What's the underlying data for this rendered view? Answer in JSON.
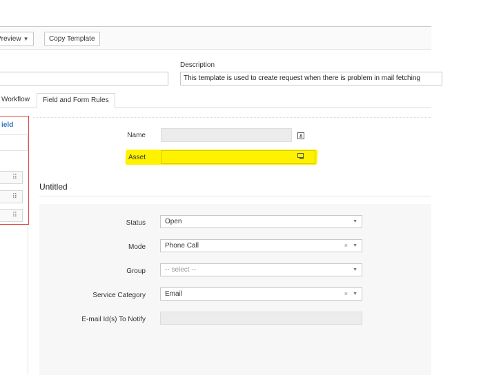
{
  "toolbar": {
    "preview_label": "Preview",
    "copy_template_label": "Copy Template"
  },
  "header": {
    "description_label": "Description",
    "description_value": "This template is used to create request when there is problem in mail fetching"
  },
  "tabs": [
    {
      "label": "Workflow"
    },
    {
      "label": "Field and Form Rules"
    }
  ],
  "left_panel": {
    "title": "ield",
    "handle_glyph": "⠿"
  },
  "main": {
    "name_label": "Name",
    "asset_label": "Asset",
    "highlight_color": "#fff200",
    "section_title": "Untitled",
    "fields": [
      {
        "label": "Status",
        "value": "Open",
        "clearable": false,
        "placeholder": false
      },
      {
        "label": "Mode",
        "value": "Phone Call",
        "clearable": true,
        "placeholder": false
      },
      {
        "label": "Group",
        "value": "-- select --",
        "clearable": false,
        "placeholder": true
      },
      {
        "label": "Service Category",
        "value": "Email",
        "clearable": true,
        "placeholder": false
      }
    ],
    "notify_label": "E-mail Id(s) To Notify"
  },
  "colors": {
    "accent_blue": "#2e6fc0",
    "panel_border_red": "#e0453f"
  }
}
